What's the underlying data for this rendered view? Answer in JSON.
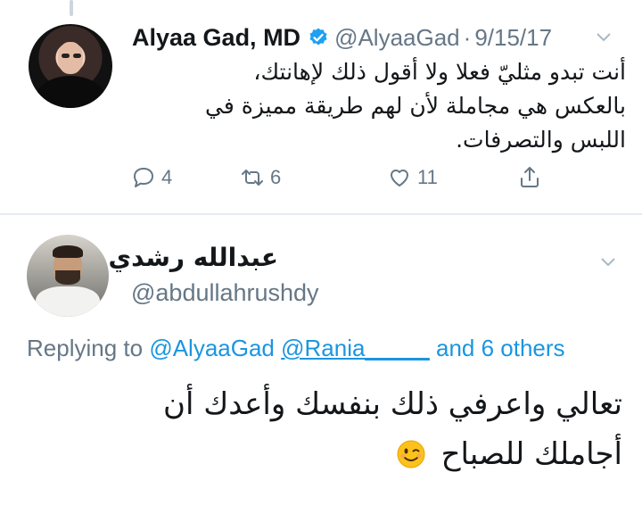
{
  "tweet": {
    "author_name": "Alyaa Gad, MD",
    "handle": "@AlyaaGad",
    "separator": "·",
    "date": "9/15/17",
    "text_lines": [
      "أنت تبدو مثليّ فعلا ولا أقول ذلك لإهانتك،",
      "بالعكس هي مجاملة لأن لهم طريقة مميزة في",
      "اللبس والتصرفات."
    ],
    "reply_count": "4",
    "retweet_count": "6",
    "like_count": "11",
    "icons": [
      "reply-icon",
      "retweet-icon",
      "like-icon",
      "share-icon",
      "verified-icon",
      "chevron-down-icon"
    ]
  },
  "reply": {
    "author_name": "عبدالله رشدي",
    "handle": "@abdullahrushdy",
    "replying_prefix": "Replying to",
    "mention_1": "@AlyaaGad",
    "mention_2": "@Rania_____",
    "others": "and 6 others",
    "text_lines": [
      "تعالي واعرفي ذلك بنفسك وأعدك أن",
      "أجاملك للصباح"
    ],
    "emoji": "winking-face"
  },
  "colors": {
    "verified": "#1da1f2",
    "secondary_text": "#657786",
    "mention": "#1b95e0"
  }
}
